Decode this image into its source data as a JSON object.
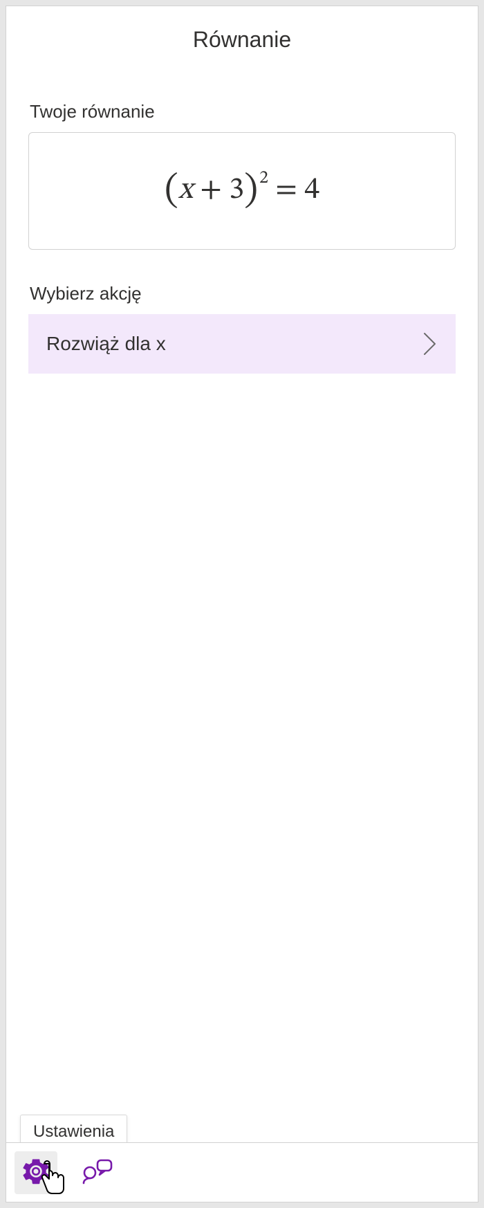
{
  "header": {
    "title": "Równanie"
  },
  "equation_section": {
    "label": "Twoje równanie",
    "equation": "(x + 3)^2 = 4"
  },
  "action_section": {
    "label": "Wybierz akcję",
    "items": [
      {
        "label": "Rozwiąż dla x"
      }
    ]
  },
  "footer": {
    "settings_tooltip": "Ustawienia",
    "icons": {
      "settings": "gear-icon",
      "feedback": "feedback-icon"
    }
  },
  "colors": {
    "accent": "#7719aa",
    "action_bg": "#f3e8fb"
  }
}
